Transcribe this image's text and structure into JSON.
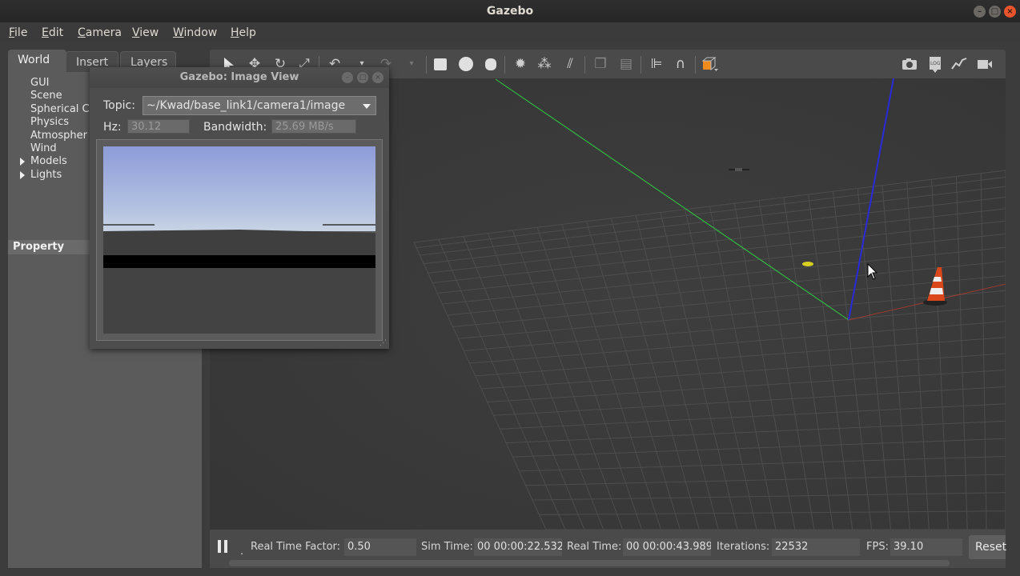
{
  "window": {
    "title": "Gazebo"
  },
  "menubar": {
    "items": [
      {
        "label": "File",
        "mnemonic": "F",
        "rest": "ile"
      },
      {
        "label": "Edit",
        "mnemonic": "E",
        "rest": "dit"
      },
      {
        "label": "Camera",
        "mnemonic": "C",
        "rest": "amera"
      },
      {
        "label": "View",
        "mnemonic": "V",
        "rest": "iew"
      },
      {
        "label": "Window",
        "mnemonic": "W",
        "rest": "indow"
      },
      {
        "label": "Help",
        "mnemonic": "H",
        "rest": "elp"
      }
    ]
  },
  "leftpanel": {
    "tabs": [
      "World",
      "Insert",
      "Layers"
    ],
    "active_tab": "World",
    "tree": [
      "GUI",
      "Scene",
      "Spherical C",
      "Physics",
      "Atmospher",
      "Wind",
      "Models",
      "Lights"
    ],
    "property_header": "Property"
  },
  "toolbar": {
    "icons": [
      "select-icon",
      "translate-icon",
      "rotate-icon",
      "scale-icon",
      "undo-icon",
      "undo-history-icon",
      "redo-icon",
      "redo-history-icon",
      "box-icon",
      "sphere-icon",
      "cylinder-icon",
      "point-light-icon",
      "spot-light-icon",
      "directional-light-icon",
      "copy-icon",
      "paste-icon",
      "align-icon",
      "snap-icon",
      "view-angle-icon",
      "screenshot-icon",
      "log-icon",
      "plot-icon",
      "record-icon"
    ]
  },
  "image_view": {
    "title": "Gazebo: Image View",
    "topic_label": "Topic:",
    "topic_value": "~/Kwad/base_link1/camera1/image",
    "hz_label": "Hz:",
    "hz_value": "30.12",
    "bandwidth_label": "Bandwidth:",
    "bandwidth_value": "25.69 MB/s"
  },
  "statusbar": {
    "dot": ".",
    "rtf_label": "Real Time Factor:",
    "rtf_value": "0.50",
    "sim_label": "Sim Time:",
    "sim_value": "00 00:00:22.532",
    "real_label": "Real Time:",
    "real_value": "00 00:00:43.989",
    "iter_label": "Iterations:",
    "iter_value": "22532",
    "fps_label": "FPS:",
    "fps_value": "39.10",
    "reset_label": "Reset"
  },
  "colors": {
    "x_axis": "#c0392b",
    "y_axis": "#2ecc40",
    "z_axis": "#2a2ad8",
    "grid": "#555555",
    "sky_top": "#8d9bd8",
    "sky_horizon": "#c6d2e4",
    "cone": "#d9471b"
  }
}
